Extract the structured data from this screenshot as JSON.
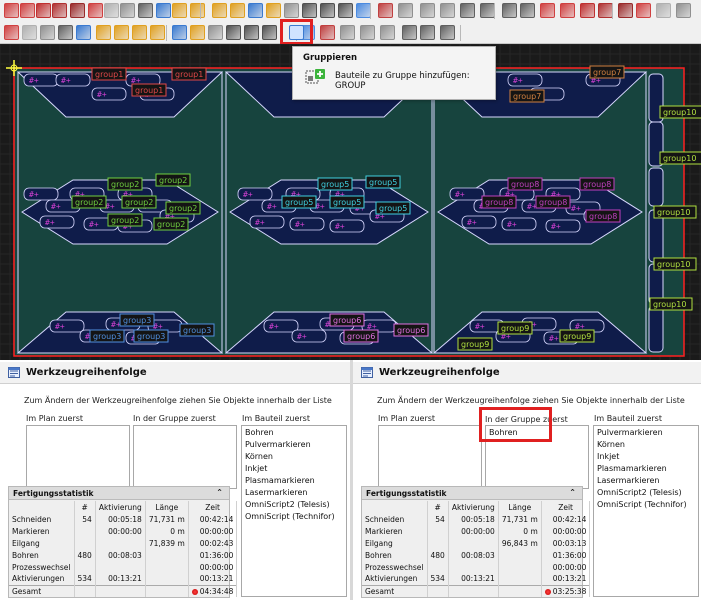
{
  "tooltip": {
    "title": "Gruppieren",
    "text": "Bauteile zu Gruppe hinzufügen: GROUP"
  },
  "canvas": {
    "group_labels": [
      "group1",
      "group1",
      "group1",
      "group2",
      "group2",
      "group2",
      "group2",
      "group2",
      "group3",
      "group3",
      "group3",
      "group5",
      "group5",
      "group5",
      "group5",
      "group5",
      "group6",
      "group6",
      "group6",
      "group7",
      "group7",
      "group8",
      "group8",
      "group8",
      "group8",
      "group8",
      "group9",
      "group9",
      "group9",
      "group10",
      "group10",
      "group10",
      "group10",
      "group10"
    ],
    "part_glyph": "#+"
  },
  "panels": [
    {
      "title": "Werkzeugreihenfolge",
      "instruction": "Zum Ändern der Werkzeugreihenfolge ziehen Sie Objekte innerhalb der Liste",
      "columns": {
        "plan": "Im Plan zuerst",
        "group": "In der Gruppe zuerst",
        "part": "Im Bauteil zuerst"
      },
      "plan_items": [],
      "group_items": [],
      "part_items": [
        "Bohren",
        "Pulvermarkieren",
        "Körnen",
        "Inkjet",
        "Plasmamarkieren",
        "Lasermarkieren",
        "OmniScript2 (Telesis)",
        "OmniScript (Technifor)"
      ],
      "stats": {
        "title": "Fertigungsstatistik",
        "headers": [
          "",
          "#",
          "Aktivierung",
          "Länge",
          "Zeit"
        ],
        "rows": [
          [
            "Schneiden",
            "54",
            "00:05:18",
            "71,731 m",
            "00:42:14"
          ],
          [
            "Markieren",
            "",
            "00:00:00",
            "0 m",
            "00:00:00"
          ],
          [
            "Eilgang",
            "",
            "",
            "71,839 m",
            "00:02:43"
          ],
          [
            "Bohren",
            "480",
            "00:08:03",
            "",
            "01:36:00"
          ],
          [
            "Prozesswechsel",
            "",
            "",
            "",
            "00:00:00"
          ],
          [
            "Aktivierungen",
            "534",
            "00:13:21",
            "",
            "00:13:21"
          ],
          [
            "Gesamt",
            "",
            "",
            "",
            "04:34:48"
          ]
        ]
      }
    },
    {
      "title": "Werkzeugreihenfolge",
      "instruction": "Zum Ändern der Werkzeugreihenfolge ziehen Sie Objekte innerhalb der Liste",
      "columns": {
        "plan": "Im Plan zuerst",
        "group": "In der Gruppe zuerst",
        "part": "Im Bauteil zuerst"
      },
      "plan_items": [],
      "group_items": [
        "Bohren"
      ],
      "part_items": [
        "Pulvermarkieren",
        "Körnen",
        "Inkjet",
        "Plasmamarkieren",
        "Lasermarkieren",
        "OmniScript2 (Telesis)",
        "OmniScript (Technifor)"
      ],
      "stats": {
        "title": "Fertigungsstatistik",
        "headers": [
          "",
          "#",
          "Aktivierung",
          "Länge",
          "Zeit"
        ],
        "rows": [
          [
            "Schneiden",
            "54",
            "00:05:18",
            "71,731 m",
            "00:42:14"
          ],
          [
            "Markieren",
            "",
            "00:00:00",
            "0 m",
            "00:00:00"
          ],
          [
            "Eilgang",
            "",
            "",
            "96,843 m",
            "00:03:13"
          ],
          [
            "Bohren",
            "480",
            "00:08:03",
            "",
            "01:36:00"
          ],
          [
            "Prozesswechsel",
            "",
            "",
            "",
            "00:00:00"
          ],
          [
            "Aktivierungen",
            "534",
            "00:13:21",
            "",
            "00:13:21"
          ],
          [
            "Gesamt",
            "",
            "",
            "",
            "03:25:38"
          ]
        ]
      }
    }
  ],
  "colors": {
    "accent_red": "#e02020",
    "sheet_border": "#ff2020",
    "part_fill": "#0f1c4a",
    "sheet_fill": "#17443e",
    "label_colors": [
      "#e06060",
      "#70d040",
      "#5090e0",
      "#40d0e0",
      "#e070e0",
      "#d08040",
      "#c040c0",
      "#b0e040"
    ]
  }
}
